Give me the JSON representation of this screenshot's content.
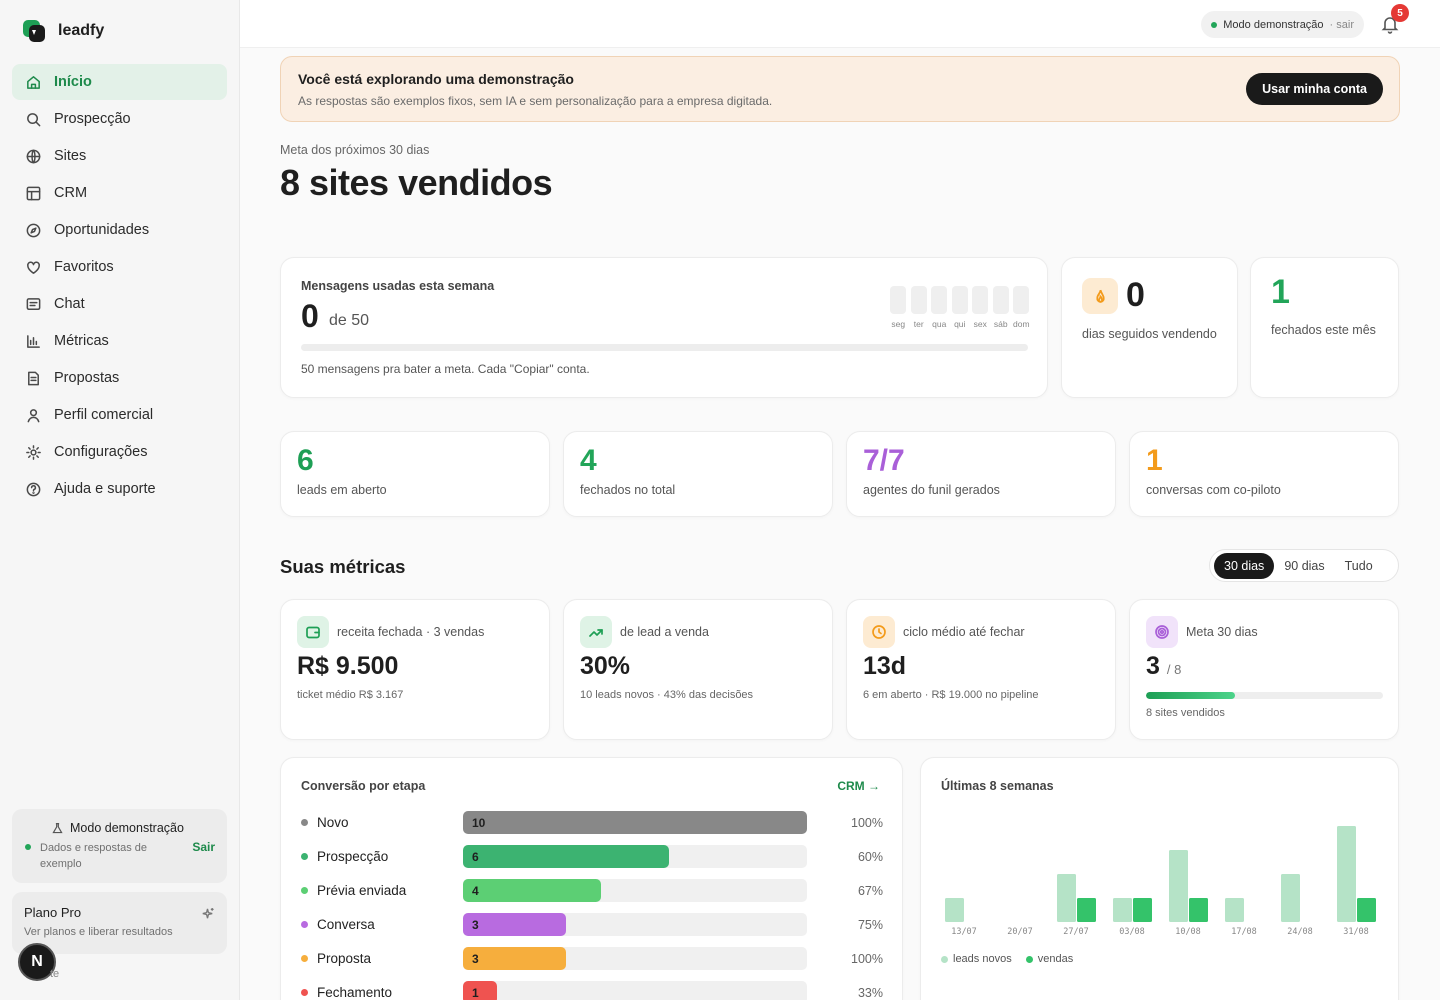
{
  "brand": {
    "name": "leadfy"
  },
  "nav": [
    {
      "label": "Início",
      "icon": "home-icon",
      "active": true
    },
    {
      "label": "Prospecção",
      "icon": "search-icon"
    },
    {
      "label": "Sites",
      "icon": "globe-icon"
    },
    {
      "label": "CRM",
      "icon": "table-icon"
    },
    {
      "label": "Oportunidades",
      "icon": "compass-icon"
    },
    {
      "label": "Favoritos",
      "icon": "heart-icon"
    },
    {
      "label": "Chat",
      "icon": "chat-icon"
    },
    {
      "label": "Métricas",
      "icon": "bar-chart-icon"
    },
    {
      "label": "Propostas",
      "icon": "document-icon"
    },
    {
      "label": "Perfil comercial",
      "icon": "user-icon"
    },
    {
      "label": "Configurações",
      "icon": "gear-icon"
    },
    {
      "label": "Ajuda e suporte",
      "icon": "help-icon"
    }
  ],
  "demo_card": {
    "title": "Modo demonstração",
    "desc": "Dados e respostas de exemplo",
    "action": "Sair"
  },
  "plan_card": {
    "title": "Plano Pro",
    "desc": "Ver planos e liberar resultados"
  },
  "avatar": {
    "initial": "N",
    "tail": "te"
  },
  "topbar": {
    "mode": "Modo demonstração",
    "mode_exit": "· sair",
    "notifications": "5"
  },
  "banner": {
    "title": "Você está explorando uma demonstração",
    "desc": "As respostas são exemplos fixos, sem IA e sem personalização para a empresa digitada.",
    "button": "Usar minha conta"
  },
  "goal": {
    "label": "Meta dos próximos 30 dias",
    "value": "8 sites vendidos"
  },
  "messages": {
    "label": "Mensagens usadas esta semana",
    "value": "0",
    "of": "de 50",
    "days": [
      "seg",
      "ter",
      "qua",
      "qui",
      "sex",
      "sáb",
      "dom"
    ],
    "note": "50 mensagens pra bater a meta. Cada \"Copiar\" conta."
  },
  "streak": {
    "value": "0",
    "label": "dias seguidos vendendo"
  },
  "closed_month": {
    "value": "1",
    "label": "fechados este mês"
  },
  "stats": [
    {
      "value": "6",
      "label": "leads em aberto",
      "color": "#1e9f55"
    },
    {
      "value": "4",
      "label": "fechados no total",
      "color": "#22a559"
    },
    {
      "value": "7/7",
      "label": "agentes do funil gerados",
      "color": "#a95fd8"
    },
    {
      "value": "1",
      "label": "conversas com co-piloto",
      "color": "#f39b1b"
    }
  ],
  "metrics_section": {
    "title": "Suas métricas",
    "ranges": [
      "30 dias",
      "90 dias",
      "Tudo"
    ],
    "active_range": 0
  },
  "metrics": [
    {
      "label": "receita fechada · 3 vendas",
      "value": "R$ 9.500",
      "sub": "ticket médio R$ 3.167",
      "icon": "wallet-icon",
      "icon_bg": "#dff3e6",
      "icon_color": "#1e9f55"
    },
    {
      "label": "de lead a venda",
      "value": "30%",
      "sub": "10 leads novos · 43% das decisões",
      "icon": "trend-up-icon",
      "icon_bg": "#dff3e6",
      "icon_color": "#1e9f55"
    },
    {
      "label": "ciclo médio até fechar",
      "value": "13d",
      "sub": "6 em aberto · R$ 19.000 no pipeline",
      "icon": "clock-icon",
      "icon_bg": "#fdebd2",
      "icon_color": "#f39b1b"
    },
    {
      "label": "Meta 30 dias",
      "value": "3",
      "value_suffix": "/ 8",
      "sub": "8 sites vendidos",
      "progress": 0.375,
      "icon": "target-icon",
      "icon_bg": "#f1e3fa",
      "icon_color": "#a95fd8"
    }
  ],
  "conversion": {
    "title": "Conversão por etapa",
    "link": "CRM →",
    "stages": [
      {
        "name": "Novo",
        "count": 10,
        "pct": "100%",
        "color": "#888888"
      },
      {
        "name": "Prospecção",
        "count": 6,
        "pct": "60%",
        "color": "#3cb371"
      },
      {
        "name": "Prévia enviada",
        "count": 4,
        "pct": "67%",
        "color": "#5ccf74"
      },
      {
        "name": "Conversa",
        "count": 3,
        "pct": "75%",
        "color": "#b86be0"
      },
      {
        "name": "Proposta",
        "count": 3,
        "pct": "100%",
        "color": "#f6ae3d"
      },
      {
        "name": "Fechamento",
        "count": 1,
        "pct": "33%",
        "color": "#ef5350"
      }
    ],
    "max": 10
  },
  "weekly": {
    "title": "Últimas 8 semanas",
    "legend": [
      "leads novos",
      "vendas"
    ],
    "colors": {
      "leads": "#b5e3c7",
      "vendas": "#34c36a"
    }
  },
  "chart_data": {
    "type": "bar",
    "title": "Últimas 8 semanas",
    "categories": [
      "13/07",
      "20/07",
      "27/07",
      "03/08",
      "10/08",
      "17/08",
      "24/08",
      "31/08"
    ],
    "series": [
      {
        "name": "leads novos",
        "values": [
          1,
          0,
          2,
          1,
          3,
          1,
          2,
          4
        ]
      },
      {
        "name": "vendas",
        "values": [
          0,
          0,
          1,
          1,
          1,
          0,
          0,
          1
        ]
      }
    ],
    "ylim": [
      0,
      4
    ]
  }
}
